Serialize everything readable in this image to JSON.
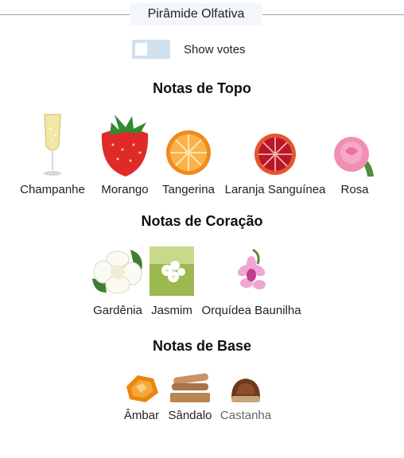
{
  "header": {
    "title": "Pirâmide Olfativa"
  },
  "toggle": {
    "label": "Show votes",
    "checked": false
  },
  "sections": [
    {
      "title": "Notas de Topo",
      "notes": [
        {
          "name": "Champanhe",
          "icon": "champagne-icon"
        },
        {
          "name": "Morango",
          "icon": "strawberry-icon"
        },
        {
          "name": "Tangerina",
          "icon": "tangerine-icon"
        },
        {
          "name": "Laranja Sanguínea",
          "icon": "blood-orange-icon"
        },
        {
          "name": "Rosa",
          "icon": "rose-icon"
        }
      ]
    },
    {
      "title": "Notas de Coração",
      "notes": [
        {
          "name": "Gardênia",
          "icon": "gardenia-icon"
        },
        {
          "name": "Jasmim",
          "icon": "jasmine-icon"
        },
        {
          "name": "Orquídea Baunilha",
          "icon": "vanilla-orchid-icon"
        }
      ]
    },
    {
      "title": "Notas de Base",
      "notes": [
        {
          "name": "Âmbar",
          "icon": "amber-icon"
        },
        {
          "name": "Sândalo",
          "icon": "sandalwood-icon"
        },
        {
          "name": "Castanha",
          "icon": "chestnut-icon"
        }
      ]
    }
  ]
}
